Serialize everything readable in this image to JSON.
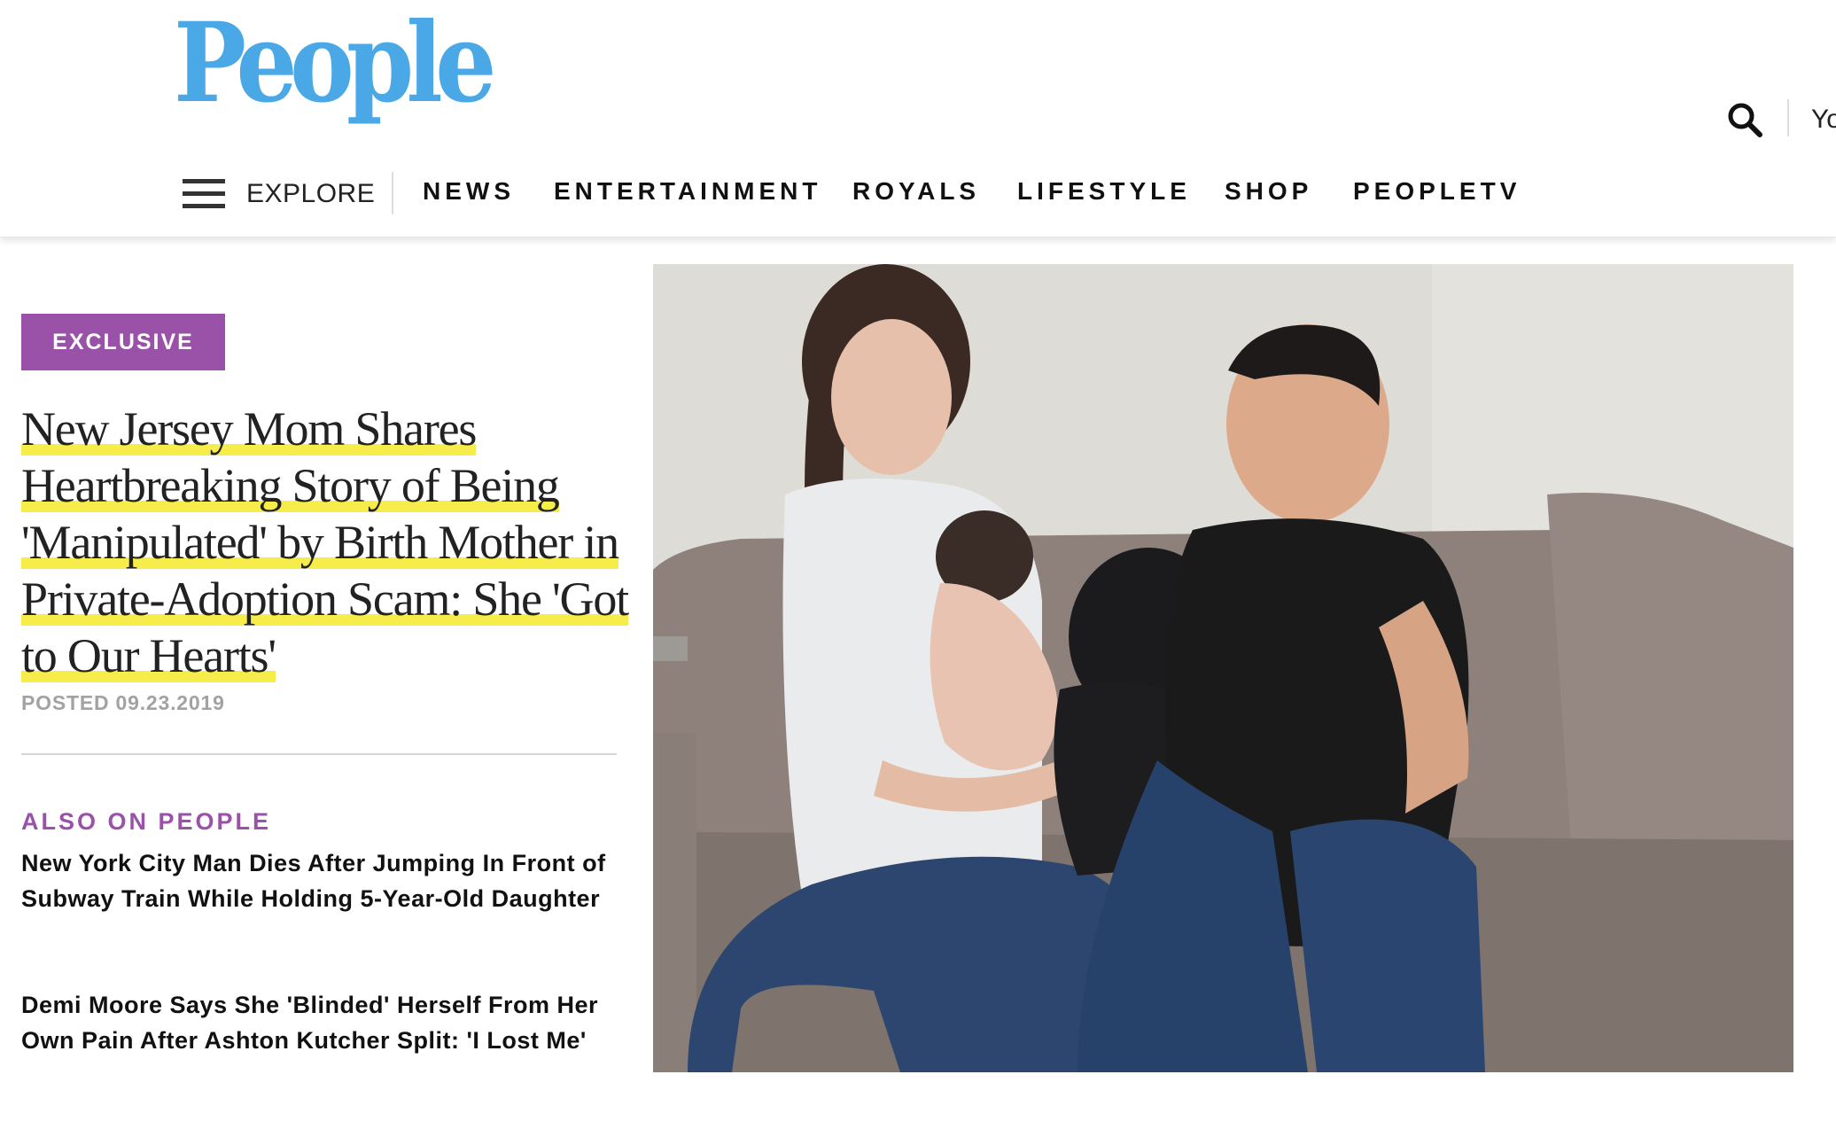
{
  "header": {
    "logo_text": "People",
    "account_label": "Yo",
    "explore_label": "EXPLORE",
    "nav": [
      "NEWS",
      "ENTERTAINMENT",
      "ROYALS",
      "LIFESTYLE",
      "SHOP",
      "PEOPLETV"
    ]
  },
  "article": {
    "badge": "EXCLUSIVE",
    "headline": "New Jersey Mom Shares Heartbreaking Story of Being 'Manipulated' by Birth Mother in Private-Adoption Scam: She 'Got to Our Hearts'",
    "posted": "POSTED 09.23.2019"
  },
  "also_on": {
    "label": "ALSO ON PEOPLE",
    "items": [
      "New York City Man Dies After Jumping In Front of Subway Train While Holding 5-Year-Old Daughter",
      "Demi Moore Says She 'Blinded' Herself From Her Own Pain After Ashton Kutcher Split: 'I Lost Me'"
    ]
  },
  "colors": {
    "brand_blue": "#4aa8e6",
    "badge_purple": "#9a52a8",
    "highlight_yellow": "#f6ec4a"
  },
  "icons": [
    "search-icon",
    "menu-icon"
  ]
}
